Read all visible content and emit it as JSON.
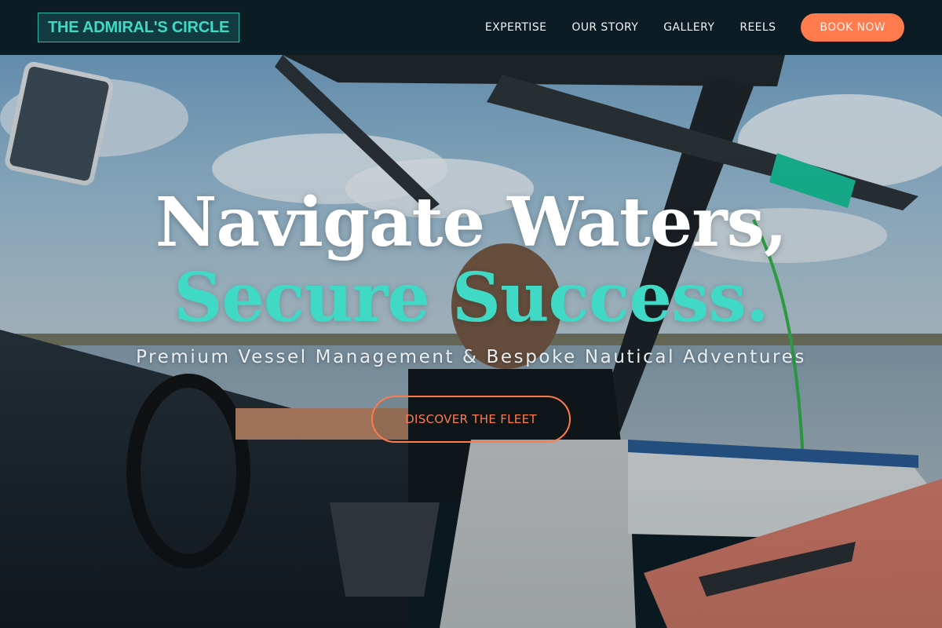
{
  "nav": {
    "logo": "THE ADMIRAL'S CIRCLE",
    "links": [
      "EXPERTISE",
      "OUR STORY",
      "GALLERY",
      "REELS"
    ],
    "book_label": "BOOK NOW"
  },
  "hero": {
    "headline_line1": "Navigate Waters,",
    "headline_line2": "Secure Success.",
    "subtitle": "Premium Vessel Management & Bespoke Nautical Adventures",
    "cta_label": "DISCOVER THE FLEET"
  },
  "colors": {
    "accent_teal": "#3fd9c5",
    "accent_orange": "#ff7a4d",
    "nav_background": "#0c1c25"
  }
}
